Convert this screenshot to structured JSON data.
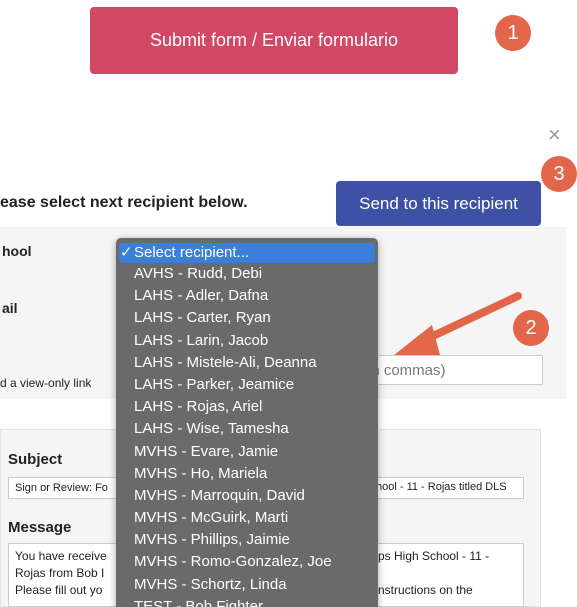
{
  "submit_button": {
    "label": "Submit form / Enviar formulario"
  },
  "steps": [
    "1",
    "2",
    "3"
  ],
  "close_icon": "×",
  "recipient_section": {
    "prompt": "ease select next recipient below.",
    "send_button": "Send to this recipient",
    "school_label": "hool",
    "email_label": "ail",
    "view_only_text": "d a view-only link",
    "email_placeholder": "with commas)"
  },
  "dropdown": {
    "selected_check": "✓",
    "options": [
      "Select recipient...",
      "AVHS - Rudd, Debi",
      "LAHS - Adler, Dafna",
      "LAHS - Carter, Ryan",
      "LAHS - Larin, Jacob",
      "LAHS - Mistele-Ali, Deanna",
      "LAHS - Parker, Jeamice",
      "LAHS - Rojas, Ariel",
      "LAHS - Wise, Tamesha",
      "MVHS - Evare, Jamie",
      "MVHS - Ho, Mariela",
      "MVHS - Marroquin, David",
      "MVHS - McGuirk, Marti",
      "MVHS - Phillips, Jaimie",
      "MVHS - Romo-Gonzalez, Joe",
      "MVHS - Schortz, Linda",
      "TEST - Bob Fighter"
    ]
  },
  "email_section": {
    "subject_label": "Subject",
    "subject_value": "Sign or Review: Fo",
    "subject_tail": "hool - 11 - Rojas titled DLS",
    "message_label": "Message",
    "message_lines": [
      "You have receive",
      "Rojas from Bob I",
      "Please fill out yo"
    ],
    "message_tails": [
      "ps High School - 11 -",
      "",
      "nstructions on the"
    ]
  },
  "colors": {
    "submit": "#d24864",
    "badge": "#e2664a",
    "send": "#3f51a5",
    "arrow": "#e2664a",
    "dropdown_bg": "#6a6a6a",
    "dropdown_selected": "#3a7fd9"
  }
}
